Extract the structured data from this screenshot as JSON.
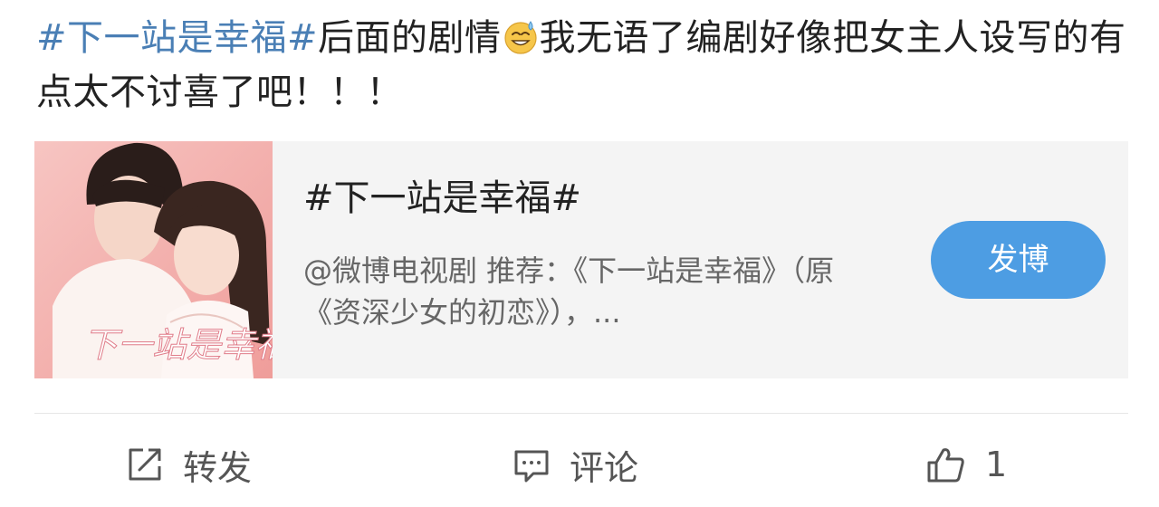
{
  "post": {
    "topic": "#下一站是幸福#",
    "text_part1": "后面的剧情",
    "emoji": "sweat-smile-emoji",
    "text_part2": "我无语了编剧好像把女主人设写的有点太不讨喜了吧！！！"
  },
  "card": {
    "poster_title": "下一站是幸福",
    "title": "#下一站是幸福#",
    "description": "@微博电视剧 推荐：《下一站是幸福》（原《资深少女的初恋》），...",
    "button_label": "发博"
  },
  "actions": {
    "repost_label": "转发",
    "comment_label": "评论",
    "like_count": "1"
  },
  "icons": {
    "repost": "share-icon",
    "comment": "comment-icon",
    "like": "thumbs-up-icon"
  },
  "colors": {
    "topic_link": "#4a7fb5",
    "button": "#4d9de3",
    "card_bg": "#f4f4f4"
  }
}
